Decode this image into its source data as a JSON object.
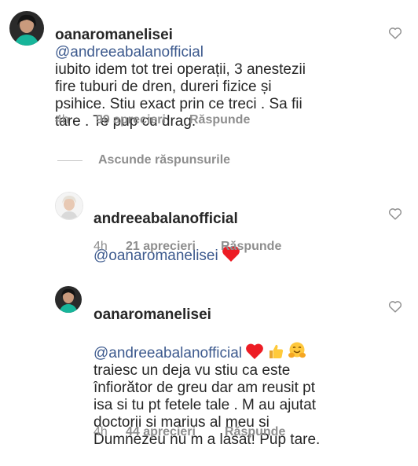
{
  "comments": [
    {
      "username": "oanaromanelisei",
      "mention": "@andreeabalanofficial",
      "text": "iubito idem tot trei operații,  3 anestezii\nfire tuburi de dren,  dureri fizice și\npsihice.  Stiu exact prin  ce treci . Sa fii\ntare . Te pup cu drag.",
      "time": "4h",
      "likes": "99 aprecieri",
      "reply": "Răspunde"
    },
    {
      "username": "andreeabalanofficial",
      "mention": "@oanaromanelisei",
      "text": "",
      "time": "4h",
      "likes": "21 aprecieri",
      "reply": "Răspunde"
    },
    {
      "username": "oanaromanelisei",
      "mention": "@andreeabalanofficial",
      "text": "traiesc un deja vu stiu ca este\nînfiorător de greu  dar am reusit pt\nisa si tu pt fetele tale . M au ajutat\ndoctorii si marius  al meu si\nDumnezeu nu m a lasat!  Pup tare.",
      "time": "4h",
      "likes": "44 aprecieri",
      "reply": "Răspunde"
    }
  ],
  "hide_replies_label": "Ascunde răspunsurile",
  "icons": {
    "like": "heart-outline-icon",
    "red_heart": "red-heart-emoji",
    "thumbs_up": "thumbs-up-emoji",
    "hug": "hugging-face-emoji"
  },
  "colors": {
    "text": "#262626",
    "muted": "#8e8e8e",
    "mention": "#3d5a8e",
    "heart": "#ed1c24"
  }
}
